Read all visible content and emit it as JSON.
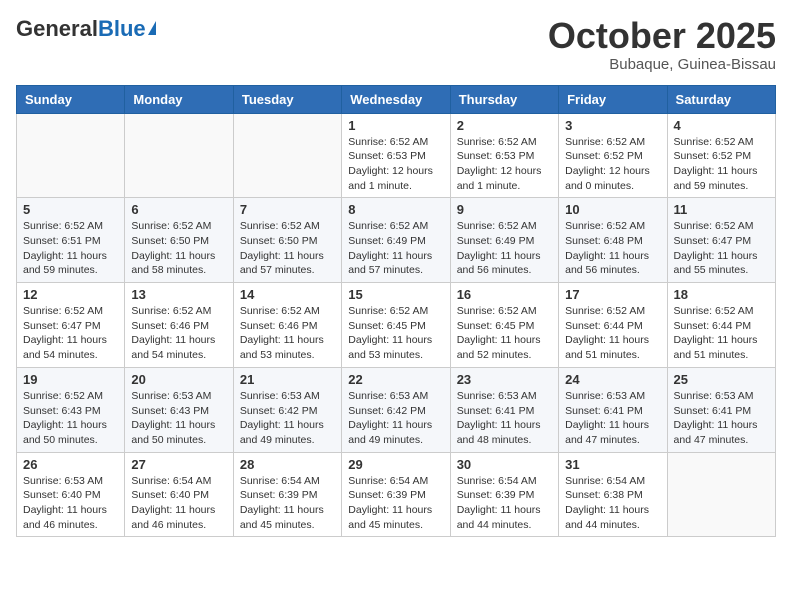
{
  "header": {
    "logo_general": "General",
    "logo_blue": "Blue",
    "month_title": "October 2025",
    "location": "Bubaque, Guinea-Bissau"
  },
  "days_of_week": [
    "Sunday",
    "Monday",
    "Tuesday",
    "Wednesday",
    "Thursday",
    "Friday",
    "Saturday"
  ],
  "weeks": [
    [
      {
        "day": "",
        "info": ""
      },
      {
        "day": "",
        "info": ""
      },
      {
        "day": "",
        "info": ""
      },
      {
        "day": "1",
        "info": "Sunrise: 6:52 AM\nSunset: 6:53 PM\nDaylight: 12 hours\nand 1 minute."
      },
      {
        "day": "2",
        "info": "Sunrise: 6:52 AM\nSunset: 6:53 PM\nDaylight: 12 hours\nand 1 minute."
      },
      {
        "day": "3",
        "info": "Sunrise: 6:52 AM\nSunset: 6:52 PM\nDaylight: 12 hours\nand 0 minutes."
      },
      {
        "day": "4",
        "info": "Sunrise: 6:52 AM\nSunset: 6:52 PM\nDaylight: 11 hours\nand 59 minutes."
      }
    ],
    [
      {
        "day": "5",
        "info": "Sunrise: 6:52 AM\nSunset: 6:51 PM\nDaylight: 11 hours\nand 59 minutes."
      },
      {
        "day": "6",
        "info": "Sunrise: 6:52 AM\nSunset: 6:50 PM\nDaylight: 11 hours\nand 58 minutes."
      },
      {
        "day": "7",
        "info": "Sunrise: 6:52 AM\nSunset: 6:50 PM\nDaylight: 11 hours\nand 57 minutes."
      },
      {
        "day": "8",
        "info": "Sunrise: 6:52 AM\nSunset: 6:49 PM\nDaylight: 11 hours\nand 57 minutes."
      },
      {
        "day": "9",
        "info": "Sunrise: 6:52 AM\nSunset: 6:49 PM\nDaylight: 11 hours\nand 56 minutes."
      },
      {
        "day": "10",
        "info": "Sunrise: 6:52 AM\nSunset: 6:48 PM\nDaylight: 11 hours\nand 56 minutes."
      },
      {
        "day": "11",
        "info": "Sunrise: 6:52 AM\nSunset: 6:47 PM\nDaylight: 11 hours\nand 55 minutes."
      }
    ],
    [
      {
        "day": "12",
        "info": "Sunrise: 6:52 AM\nSunset: 6:47 PM\nDaylight: 11 hours\nand 54 minutes."
      },
      {
        "day": "13",
        "info": "Sunrise: 6:52 AM\nSunset: 6:46 PM\nDaylight: 11 hours\nand 54 minutes."
      },
      {
        "day": "14",
        "info": "Sunrise: 6:52 AM\nSunset: 6:46 PM\nDaylight: 11 hours\nand 53 minutes."
      },
      {
        "day": "15",
        "info": "Sunrise: 6:52 AM\nSunset: 6:45 PM\nDaylight: 11 hours\nand 53 minutes."
      },
      {
        "day": "16",
        "info": "Sunrise: 6:52 AM\nSunset: 6:45 PM\nDaylight: 11 hours\nand 52 minutes."
      },
      {
        "day": "17",
        "info": "Sunrise: 6:52 AM\nSunset: 6:44 PM\nDaylight: 11 hours\nand 51 minutes."
      },
      {
        "day": "18",
        "info": "Sunrise: 6:52 AM\nSunset: 6:44 PM\nDaylight: 11 hours\nand 51 minutes."
      }
    ],
    [
      {
        "day": "19",
        "info": "Sunrise: 6:52 AM\nSunset: 6:43 PM\nDaylight: 11 hours\nand 50 minutes."
      },
      {
        "day": "20",
        "info": "Sunrise: 6:53 AM\nSunset: 6:43 PM\nDaylight: 11 hours\nand 50 minutes."
      },
      {
        "day": "21",
        "info": "Sunrise: 6:53 AM\nSunset: 6:42 PM\nDaylight: 11 hours\nand 49 minutes."
      },
      {
        "day": "22",
        "info": "Sunrise: 6:53 AM\nSunset: 6:42 PM\nDaylight: 11 hours\nand 49 minutes."
      },
      {
        "day": "23",
        "info": "Sunrise: 6:53 AM\nSunset: 6:41 PM\nDaylight: 11 hours\nand 48 minutes."
      },
      {
        "day": "24",
        "info": "Sunrise: 6:53 AM\nSunset: 6:41 PM\nDaylight: 11 hours\nand 47 minutes."
      },
      {
        "day": "25",
        "info": "Sunrise: 6:53 AM\nSunset: 6:41 PM\nDaylight: 11 hours\nand 47 minutes."
      }
    ],
    [
      {
        "day": "26",
        "info": "Sunrise: 6:53 AM\nSunset: 6:40 PM\nDaylight: 11 hours\nand 46 minutes."
      },
      {
        "day": "27",
        "info": "Sunrise: 6:54 AM\nSunset: 6:40 PM\nDaylight: 11 hours\nand 46 minutes."
      },
      {
        "day": "28",
        "info": "Sunrise: 6:54 AM\nSunset: 6:39 PM\nDaylight: 11 hours\nand 45 minutes."
      },
      {
        "day": "29",
        "info": "Sunrise: 6:54 AM\nSunset: 6:39 PM\nDaylight: 11 hours\nand 45 minutes."
      },
      {
        "day": "30",
        "info": "Sunrise: 6:54 AM\nSunset: 6:39 PM\nDaylight: 11 hours\nand 44 minutes."
      },
      {
        "day": "31",
        "info": "Sunrise: 6:54 AM\nSunset: 6:38 PM\nDaylight: 11 hours\nand 44 minutes."
      },
      {
        "day": "",
        "info": ""
      }
    ]
  ]
}
